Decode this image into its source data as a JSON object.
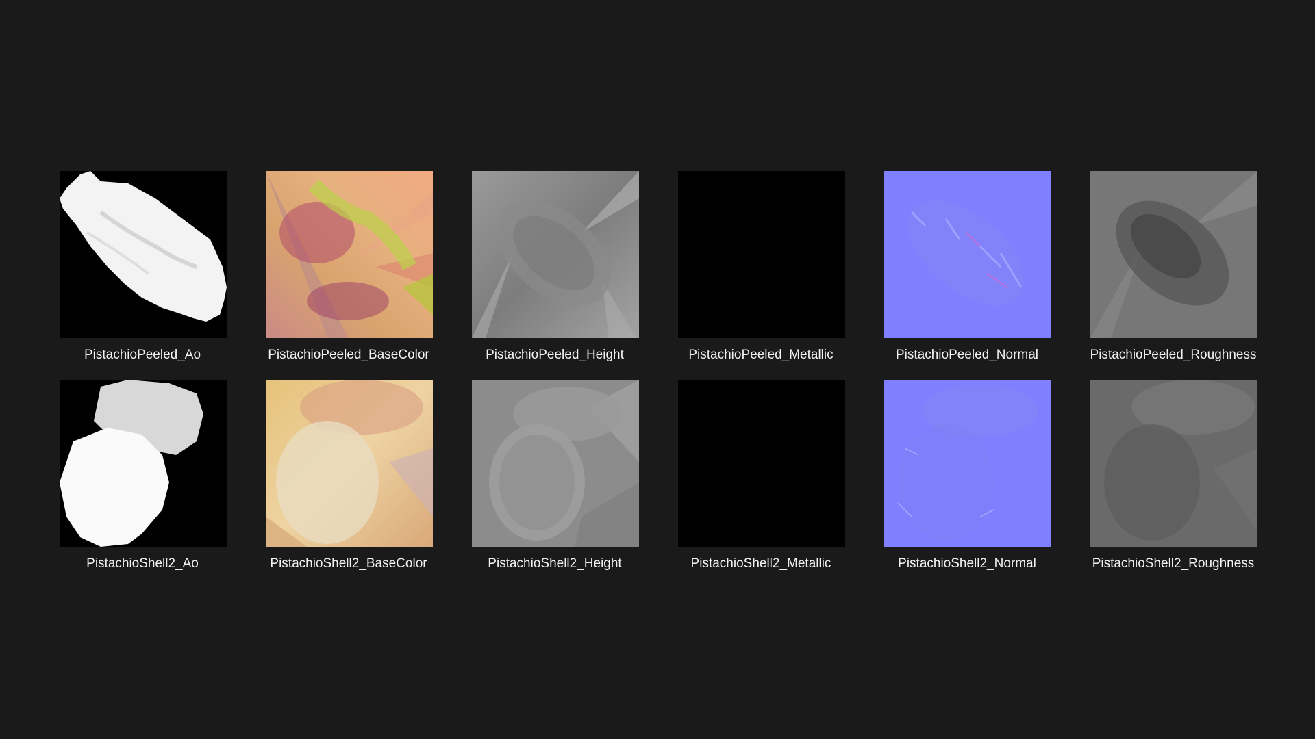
{
  "background_color": "#1a1a1a",
  "files": [
    {
      "name": "PistachioPeeled_Ao",
      "kind": "ao-peeled-image"
    },
    {
      "name": "PistachioPeeled_BaseColor",
      "kind": "basecolor-peeled-image"
    },
    {
      "name": "PistachioPeeled_Height",
      "kind": "height-peeled-image"
    },
    {
      "name": "PistachioPeeled_Metallic",
      "kind": "metallic-image"
    },
    {
      "name": "PistachioPeeled_Normal",
      "kind": "normal-peeled-image"
    },
    {
      "name": "PistachioPeeled_Roughness",
      "kind": "roughness-peeled-image"
    },
    {
      "name": "PistachioShell2_Ao",
      "kind": "ao-shell-image"
    },
    {
      "name": "PistachioShell2_BaseColor",
      "kind": "basecolor-shell-image"
    },
    {
      "name": "PistachioShell2_Height",
      "kind": "height-shell-image"
    },
    {
      "name": "PistachioShell2_Metallic",
      "kind": "metallic-image"
    },
    {
      "name": "PistachioShell2_Normal",
      "kind": "normal-shell-image"
    },
    {
      "name": "PistachioShell2_Roughness",
      "kind": "roughness-shell-image"
    }
  ]
}
